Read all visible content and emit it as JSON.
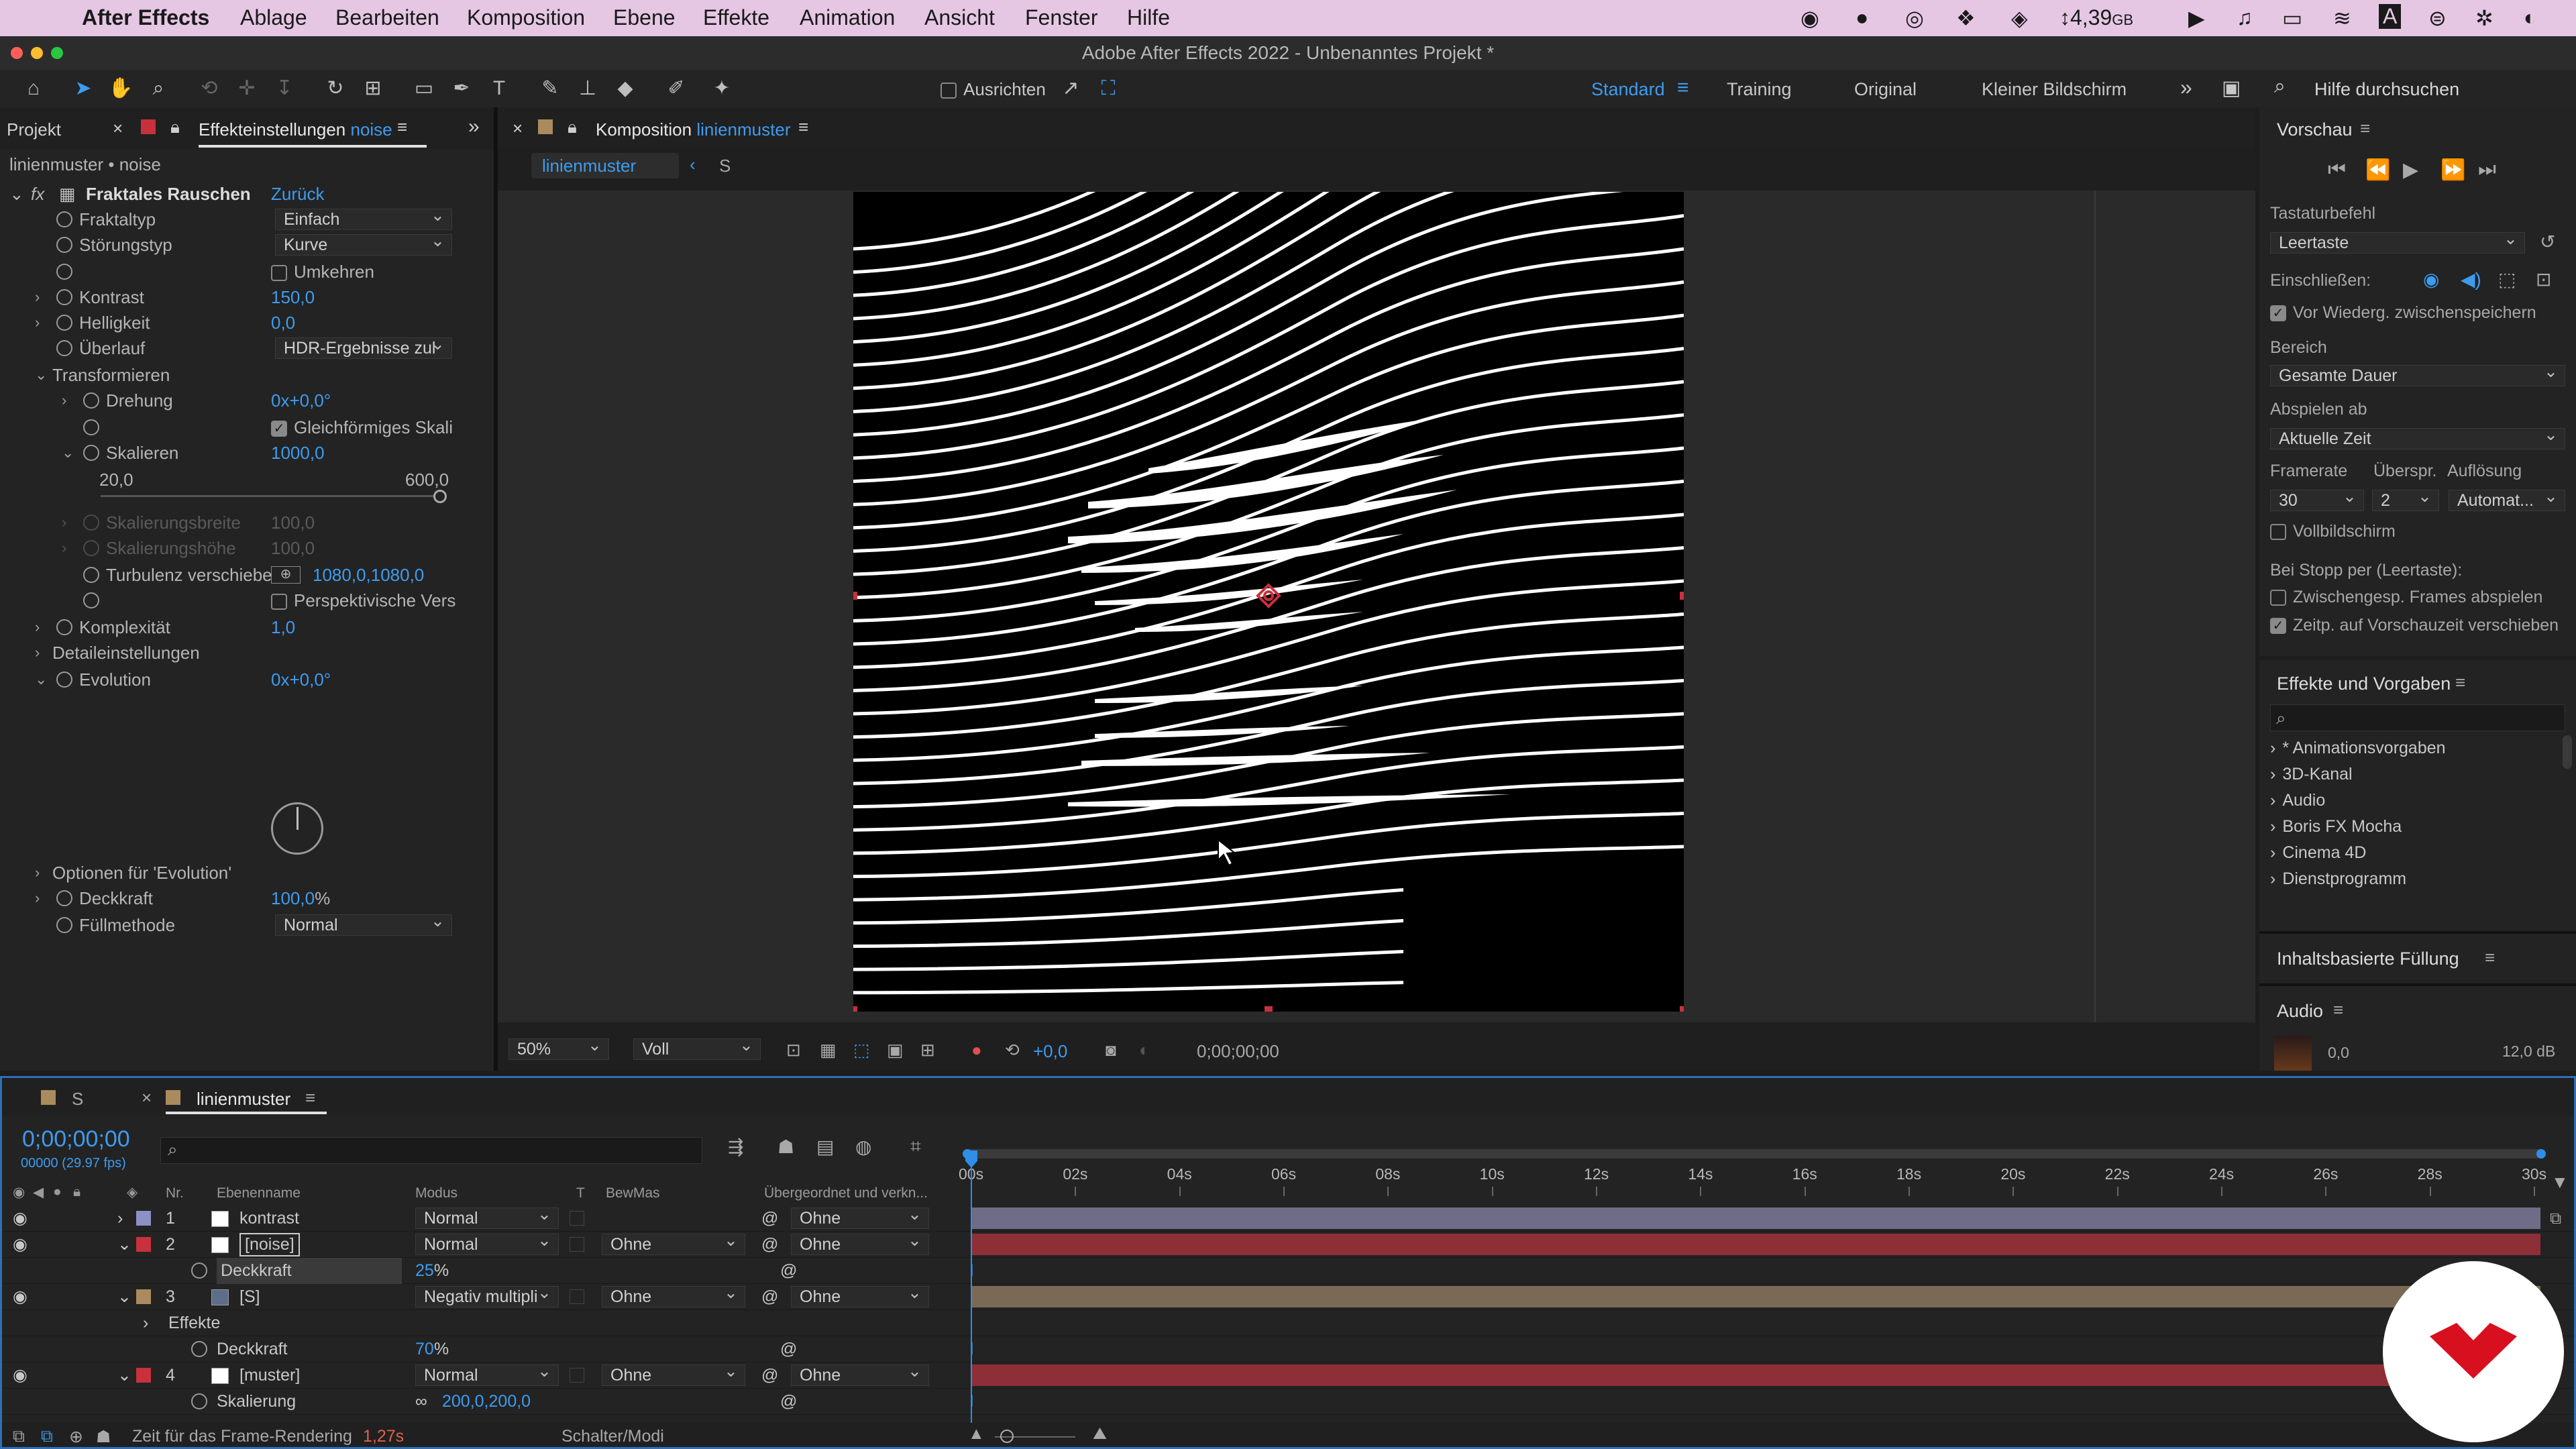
{
  "menubar": {
    "app": "After Effects",
    "items": [
      "Ablage",
      "Bearbeiten",
      "Komposition",
      "Ebene",
      "Effekte",
      "Animation",
      "Ansicht",
      "Fenster",
      "Hilfe"
    ],
    "disk": "4,39",
    "disk_unit": "GB"
  },
  "window_title": "Adobe After Effects 2022 - Unbenanntes Projekt *",
  "toolbar": {
    "snap_label": "Ausrichten",
    "workspaces": [
      "Standard",
      "Training",
      "Original",
      "Kleiner Bildschirm"
    ],
    "help_placeholder": "Hilfe durchsuchen"
  },
  "effects_panel": {
    "tab_project": "Projekt",
    "tab_effects": "Effekteinstellungen",
    "tab_effects_layer": "noise",
    "header": "linienmuster • noise",
    "effect_name": "Fraktales Rauschen",
    "reset": "Zurück",
    "rows": {
      "fraktaltyp": "Fraktaltyp",
      "fraktaltyp_val": "Einfach",
      "stoerung": "Störungstyp",
      "stoerung_val": "Kurve",
      "umkehren": "Umkehren",
      "kontrast": "Kontrast",
      "kontrast_val": "150,0",
      "helligkeit": "Helligkeit",
      "helligkeit_val": "0,0",
      "ueberlauf": "Überlauf",
      "ueberlauf_val": "HDR-Ergebnisse zul",
      "transformieren": "Transformieren",
      "drehung": "Drehung",
      "drehung_val": "0x+0,0°",
      "gleichf": "Gleichförmiges Skali",
      "skalieren": "Skalieren",
      "skalieren_val": "1000,0",
      "slider_min": "20,0",
      "slider_max": "600,0",
      "skal_breite": "Skalierungsbreite",
      "skal_breite_val": "100,0",
      "skal_hoehe": "Skalierungshöhe",
      "skal_hoehe_val": "100,0",
      "turbulenz": "Turbulenz verschiebe",
      "turbulenz_val": "1080,0,1080,0",
      "perspektiv": "Perspektivische Vers",
      "komplex": "Komplexität",
      "komplex_val": "1,0",
      "detail": "Detaileinstellungen",
      "evolution": "Evolution",
      "evolution_val": "0x+0,0°",
      "opt_evolution": "Optionen für 'Evolution'",
      "deckkraft": "Deckkraft",
      "deckkraft_val": "100,0",
      "deckkraft_unit": "%",
      "fuell": "Füllmethode",
      "fuell_val": "Normal"
    }
  },
  "comp_panel": {
    "tab_label": "Komposition",
    "tab_comp": "linienmuster",
    "flow_comp": "linienmuster",
    "flow_next": "S",
    "zoom": "50%",
    "resolution": "Voll",
    "exposure": "+0,0",
    "timecode": "0;00;00;00"
  },
  "preview_panel": {
    "title": "Vorschau",
    "shortcut_label": "Tastaturbefehl",
    "shortcut_val": "Leertaste",
    "include_label": "Einschließen:",
    "cache_label": "Vor Wiederg. zwischenspeichern",
    "range_label": "Bereich",
    "range_val": "Gesamte Dauer",
    "play_from_label": "Abspielen ab",
    "play_from_val": "Aktuelle Zeit",
    "framerate_label": "Framerate",
    "skip_label": "Überspr.",
    "resolution_label": "Auflösung",
    "framerate_val": "30",
    "skip_val": "2",
    "resolution_val": "Automat...",
    "fullscreen_label": "Vollbildschirm",
    "on_stop_label": "Bei Stopp per (Leertaste):",
    "cached_frames_label": "Zwischengesp. Frames abspielen",
    "move_time_label": "Zeitp. auf Vorschauzeit verschieben"
  },
  "effects_presets": {
    "title": "Effekte und Vorgaben",
    "items": [
      "* Animationsvorgaben",
      "3D-Kanal",
      "Audio",
      "Boris FX Mocha",
      "Cinema 4D",
      "Dienstprogramm"
    ]
  },
  "content_fill": {
    "title": "Inhaltsbasierte Füllung"
  },
  "audio_panel": {
    "title": "Audio",
    "left_val": "0,0",
    "right_val": "12,0 dB"
  },
  "timeline": {
    "tab_s": "S",
    "tab_comp": "linienmuster",
    "current_time": "0;00;00;00",
    "frame_info": "00000 (29.97 fps)",
    "col_nr": "Nr.",
    "col_name": "Ebenenname",
    "col_mode": "Modus",
    "col_t": "T",
    "col_trkmat": "BewMas",
    "col_parent": "Übergeordnet und verkn...",
    "ruler": [
      "00s",
      "02s",
      "04s",
      "06s",
      "08s",
      "10s",
      "12s",
      "14s",
      "16s",
      "18s",
      "20s",
      "22s",
      "24s",
      "26s",
      "28s",
      "30s"
    ],
    "layers": [
      {
        "nr": "1",
        "name": "kontrast",
        "mode": "Normal",
        "trkmat": "",
        "parent": "Ohne",
        "color": "#8d8fc6",
        "bar": "#6e6c86"
      },
      {
        "nr": "2",
        "name": "[noise]",
        "mode": "Normal",
        "trkmat": "Ohne",
        "parent": "Ohne",
        "color": "#c8313b",
        "bar": "#8e2f38"
      },
      {
        "nr": "3",
        "name": "[S]",
        "mode": "Negativ multipli",
        "trkmat": "Ohne",
        "parent": "Ohne",
        "color": "#a98b5e",
        "bar": "#7a6a55"
      },
      {
        "nr": "4",
        "name": "[muster]",
        "mode": "Normal",
        "trkmat": "Ohne",
        "parent": "Ohne",
        "color": "#c8313b",
        "bar": "#8e2f38"
      }
    ],
    "deckkraft_label": "Deckkraft",
    "noise_opacity": "25",
    "effekte_label": "Effekte",
    "s_opacity": "70",
    "percent": "%",
    "skalierung_label": "Skalierung",
    "muster_scale": "200,0,200,0",
    "render_label": "Zeit für das Frame-Rendering",
    "render_val": "1,27s",
    "switch_label": "Schalter/Modi"
  }
}
